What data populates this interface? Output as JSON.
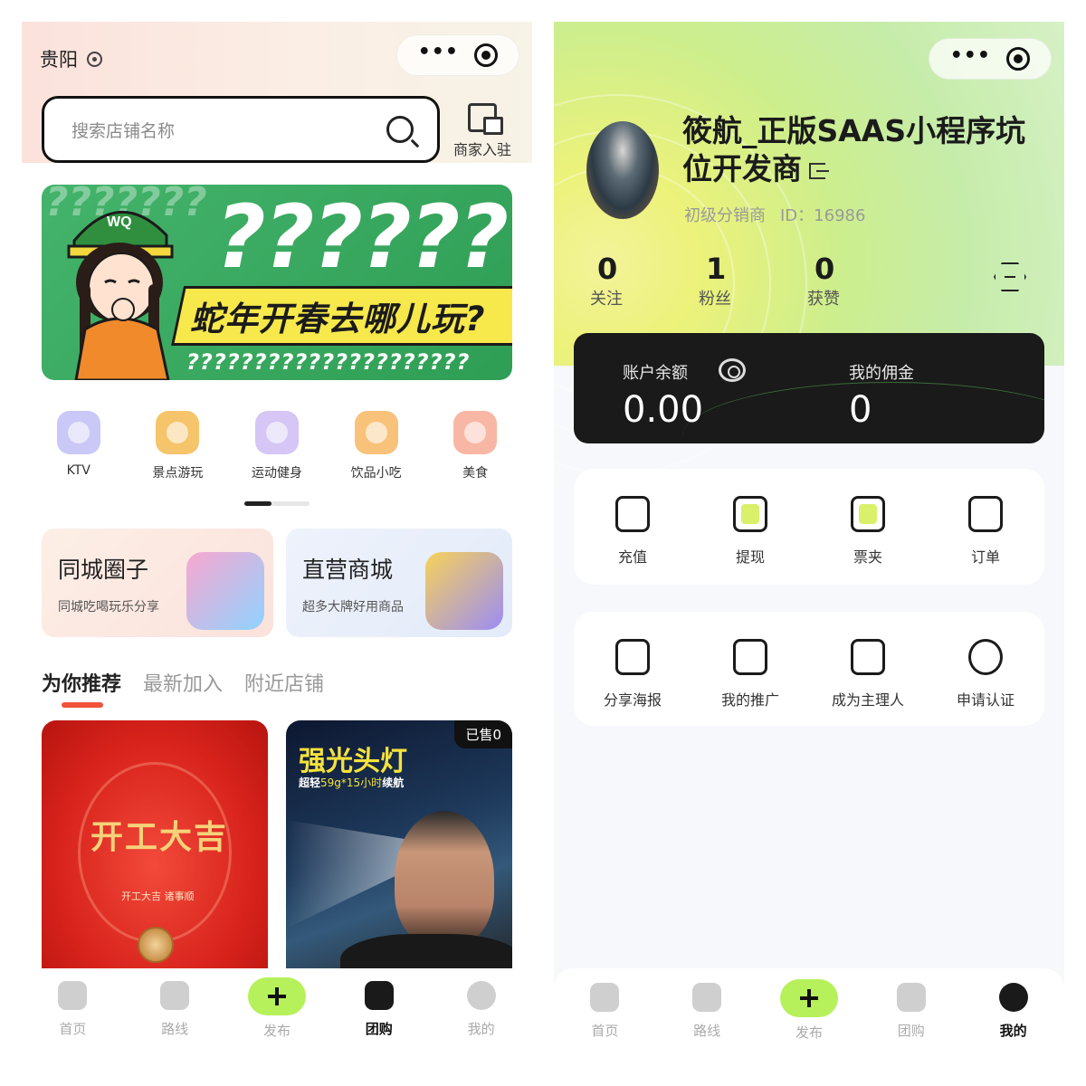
{
  "left": {
    "city": "贵阳",
    "search": {
      "placeholder": "搜索店铺名称"
    },
    "merchant_label": "商家入驻",
    "banner": {
      "question_marks": "???????",
      "slogan": "蛇年开春去哪儿玩?",
      "question_row": "?????????????????????",
      "cap_text": "WQ"
    },
    "categories": [
      {
        "label": "KTV",
        "icon": "microphone-icon",
        "color": "#c9c8f6"
      },
      {
        "label": "景点游玩",
        "icon": "map-pin-icon",
        "color": "#f6c46a"
      },
      {
        "label": "运动健身",
        "icon": "dumbbell-icon",
        "color": "#d5c6f6"
      },
      {
        "label": "饮品小吃",
        "icon": "pizza-icon",
        "color": "#f8c27a"
      },
      {
        "label": "美食",
        "icon": "food-icon",
        "color": "#f8b7a5"
      }
    ],
    "promos": [
      {
        "title": "同城圈子",
        "subtitle": "同城吃喝玩乐分享",
        "bg": "#fbe9e0",
        "accent": "#a9c8f5",
        "art": "shopping-cart-icon"
      },
      {
        "title": "直营商城",
        "subtitle": "超多大牌好用商品",
        "bg": "#e8effb",
        "accent": "#b7c9f3",
        "art": "megaphone-icon"
      }
    ],
    "rec_tabs": [
      "为你推荐",
      "最新加入",
      "附近店铺"
    ],
    "products": [
      {
        "headline": "开工大吉",
        "subtitle": "开工大吉 诸事顺"
      },
      {
        "headline": "强光头灯",
        "subtitle_pre": "超轻",
        "subtitle_hl": "59g*15小时",
        "subtitle_post": "续航",
        "sold": "已售0"
      }
    ],
    "tabbar": [
      {
        "label": "首页",
        "icon": "home-icon"
      },
      {
        "label": "路线",
        "icon": "route-icon"
      },
      {
        "label": "发布",
        "icon": "plus-icon"
      },
      {
        "label": "团购",
        "icon": "chat-icon"
      },
      {
        "label": "我的",
        "icon": "smile-icon"
      }
    ],
    "active_tab": "团购"
  },
  "right": {
    "username": "筱航_正版SAAS小程序坑位开发商",
    "role": "初级分销商",
    "id_text": "ID：16986",
    "stats": [
      {
        "value": "0",
        "label": "关注"
      },
      {
        "value": "1",
        "label": "粉丝"
      },
      {
        "value": "0",
        "label": "获赞"
      }
    ],
    "wallet": {
      "balance_label": "账户余额",
      "balance_value": "0.00",
      "commission_label": "我的佣金",
      "commission_value": "0"
    },
    "actions_row1": [
      {
        "label": "充值",
        "icon": "wallet-plus-icon"
      },
      {
        "label": "提现",
        "icon": "withdraw-icon"
      },
      {
        "label": "票夹",
        "icon": "ticket-icon"
      },
      {
        "label": "订单",
        "icon": "receipt-icon"
      }
    ],
    "actions_row2": [
      {
        "label": "分享海报",
        "icon": "share-icon"
      },
      {
        "label": "我的推广",
        "icon": "promotion-icon"
      },
      {
        "label": "成为主理人",
        "icon": "badge-icon"
      },
      {
        "label": "申请认证",
        "icon": "chat-bubbles-icon"
      }
    ],
    "tabbar": [
      {
        "label": "首页",
        "icon": "home-icon"
      },
      {
        "label": "路线",
        "icon": "route-icon"
      },
      {
        "label": "发布",
        "icon": "plus-icon"
      },
      {
        "label": "团购",
        "icon": "chat-icon"
      },
      {
        "label": "我的",
        "icon": "smile-icon"
      }
    ],
    "active_tab": "我的"
  }
}
